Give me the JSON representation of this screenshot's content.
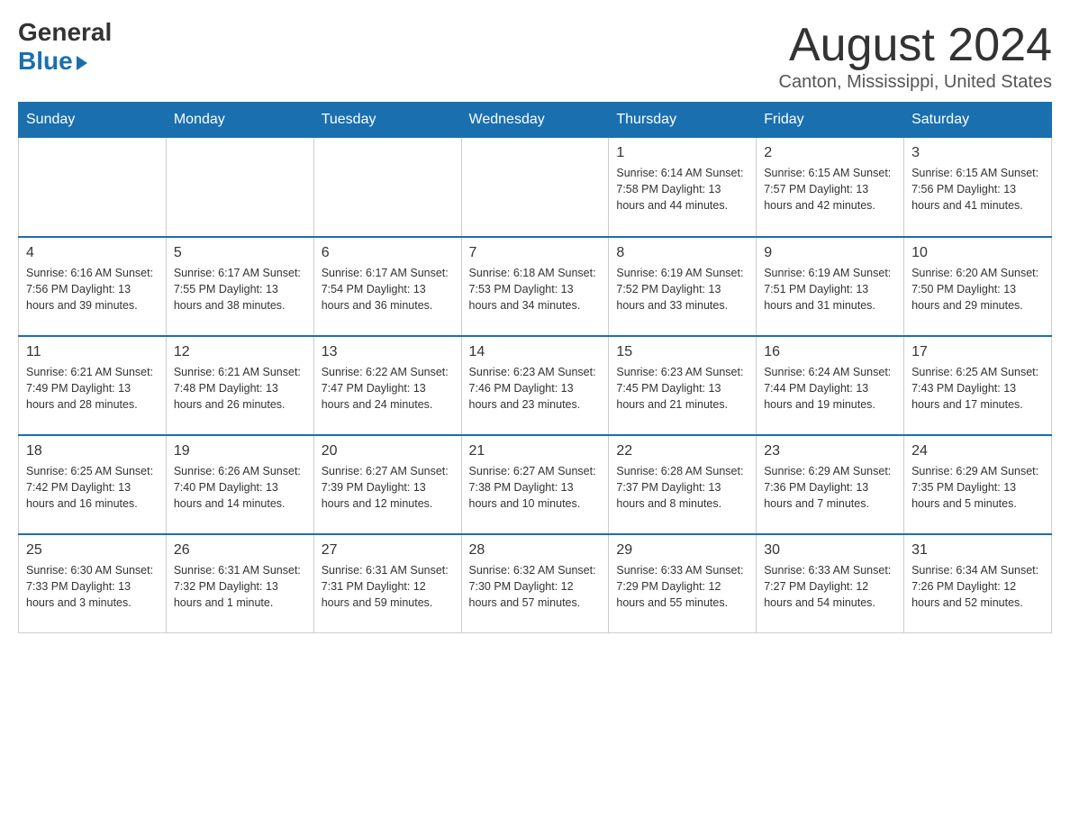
{
  "header": {
    "logo_general": "General",
    "logo_blue": "Blue",
    "month_title": "August 2024",
    "location": "Canton, Mississippi, United States"
  },
  "weekdays": [
    "Sunday",
    "Monday",
    "Tuesday",
    "Wednesday",
    "Thursday",
    "Friday",
    "Saturday"
  ],
  "weeks": [
    [
      {
        "day": "",
        "info": ""
      },
      {
        "day": "",
        "info": ""
      },
      {
        "day": "",
        "info": ""
      },
      {
        "day": "",
        "info": ""
      },
      {
        "day": "1",
        "info": "Sunrise: 6:14 AM\nSunset: 7:58 PM\nDaylight: 13 hours and 44 minutes."
      },
      {
        "day": "2",
        "info": "Sunrise: 6:15 AM\nSunset: 7:57 PM\nDaylight: 13 hours and 42 minutes."
      },
      {
        "day": "3",
        "info": "Sunrise: 6:15 AM\nSunset: 7:56 PM\nDaylight: 13 hours and 41 minutes."
      }
    ],
    [
      {
        "day": "4",
        "info": "Sunrise: 6:16 AM\nSunset: 7:56 PM\nDaylight: 13 hours and 39 minutes."
      },
      {
        "day": "5",
        "info": "Sunrise: 6:17 AM\nSunset: 7:55 PM\nDaylight: 13 hours and 38 minutes."
      },
      {
        "day": "6",
        "info": "Sunrise: 6:17 AM\nSunset: 7:54 PM\nDaylight: 13 hours and 36 minutes."
      },
      {
        "day": "7",
        "info": "Sunrise: 6:18 AM\nSunset: 7:53 PM\nDaylight: 13 hours and 34 minutes."
      },
      {
        "day": "8",
        "info": "Sunrise: 6:19 AM\nSunset: 7:52 PM\nDaylight: 13 hours and 33 minutes."
      },
      {
        "day": "9",
        "info": "Sunrise: 6:19 AM\nSunset: 7:51 PM\nDaylight: 13 hours and 31 minutes."
      },
      {
        "day": "10",
        "info": "Sunrise: 6:20 AM\nSunset: 7:50 PM\nDaylight: 13 hours and 29 minutes."
      }
    ],
    [
      {
        "day": "11",
        "info": "Sunrise: 6:21 AM\nSunset: 7:49 PM\nDaylight: 13 hours and 28 minutes."
      },
      {
        "day": "12",
        "info": "Sunrise: 6:21 AM\nSunset: 7:48 PM\nDaylight: 13 hours and 26 minutes."
      },
      {
        "day": "13",
        "info": "Sunrise: 6:22 AM\nSunset: 7:47 PM\nDaylight: 13 hours and 24 minutes."
      },
      {
        "day": "14",
        "info": "Sunrise: 6:23 AM\nSunset: 7:46 PM\nDaylight: 13 hours and 23 minutes."
      },
      {
        "day": "15",
        "info": "Sunrise: 6:23 AM\nSunset: 7:45 PM\nDaylight: 13 hours and 21 minutes."
      },
      {
        "day": "16",
        "info": "Sunrise: 6:24 AM\nSunset: 7:44 PM\nDaylight: 13 hours and 19 minutes."
      },
      {
        "day": "17",
        "info": "Sunrise: 6:25 AM\nSunset: 7:43 PM\nDaylight: 13 hours and 17 minutes."
      }
    ],
    [
      {
        "day": "18",
        "info": "Sunrise: 6:25 AM\nSunset: 7:42 PM\nDaylight: 13 hours and 16 minutes."
      },
      {
        "day": "19",
        "info": "Sunrise: 6:26 AM\nSunset: 7:40 PM\nDaylight: 13 hours and 14 minutes."
      },
      {
        "day": "20",
        "info": "Sunrise: 6:27 AM\nSunset: 7:39 PM\nDaylight: 13 hours and 12 minutes."
      },
      {
        "day": "21",
        "info": "Sunrise: 6:27 AM\nSunset: 7:38 PM\nDaylight: 13 hours and 10 minutes."
      },
      {
        "day": "22",
        "info": "Sunrise: 6:28 AM\nSunset: 7:37 PM\nDaylight: 13 hours and 8 minutes."
      },
      {
        "day": "23",
        "info": "Sunrise: 6:29 AM\nSunset: 7:36 PM\nDaylight: 13 hours and 7 minutes."
      },
      {
        "day": "24",
        "info": "Sunrise: 6:29 AM\nSunset: 7:35 PM\nDaylight: 13 hours and 5 minutes."
      }
    ],
    [
      {
        "day": "25",
        "info": "Sunrise: 6:30 AM\nSunset: 7:33 PM\nDaylight: 13 hours and 3 minutes."
      },
      {
        "day": "26",
        "info": "Sunrise: 6:31 AM\nSunset: 7:32 PM\nDaylight: 13 hours and 1 minute."
      },
      {
        "day": "27",
        "info": "Sunrise: 6:31 AM\nSunset: 7:31 PM\nDaylight: 12 hours and 59 minutes."
      },
      {
        "day": "28",
        "info": "Sunrise: 6:32 AM\nSunset: 7:30 PM\nDaylight: 12 hours and 57 minutes."
      },
      {
        "day": "29",
        "info": "Sunrise: 6:33 AM\nSunset: 7:29 PM\nDaylight: 12 hours and 55 minutes."
      },
      {
        "day": "30",
        "info": "Sunrise: 6:33 AM\nSunset: 7:27 PM\nDaylight: 12 hours and 54 minutes."
      },
      {
        "day": "31",
        "info": "Sunrise: 6:34 AM\nSunset: 7:26 PM\nDaylight: 12 hours and 52 minutes."
      }
    ]
  ]
}
